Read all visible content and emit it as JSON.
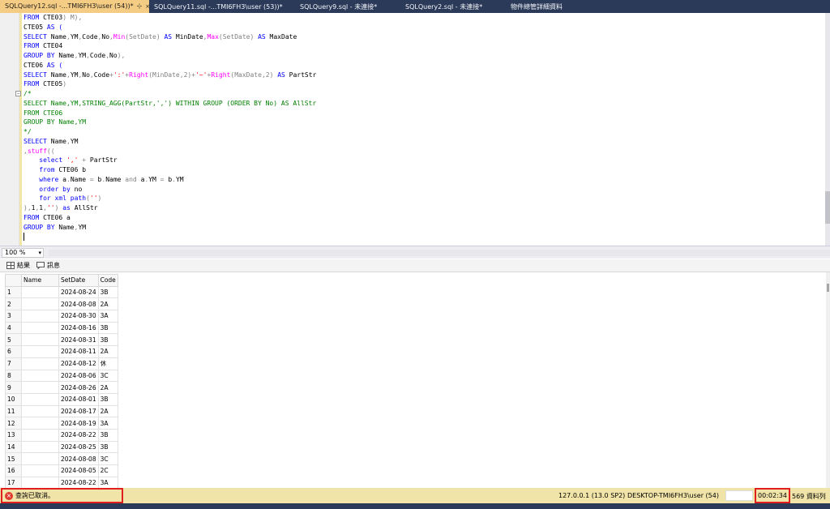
{
  "tabs": [
    {
      "label": "SQLQuery12.sql -...TMI6FH3\\user (54))*",
      "active": true
    },
    {
      "label": "SQLQuery11.sql -...TMI6FH3\\user (53))*",
      "active": false
    },
    {
      "label": "SQLQuery9.sql - 未連接*",
      "active": false
    },
    {
      "label": "SQLQuery2.sql - 未連接*",
      "active": false
    },
    {
      "label": "物件總管詳細資料",
      "active": false
    }
  ],
  "tab_controls": {
    "dropdown": "▾",
    "pin": "⊹",
    "close": "×"
  },
  "editor": {
    "lines": [
      [
        {
          "t": "FROM ",
          "c": "kw"
        },
        {
          "t": "CTE03",
          "c": ""
        },
        {
          "t": ") M),",
          "c": "gray"
        }
      ],
      [
        {
          "t": "CTE05 ",
          "c": ""
        },
        {
          "t": "AS (",
          "c": "kw"
        }
      ],
      [
        {
          "t": "SELECT ",
          "c": "kw"
        },
        {
          "t": "Name",
          "c": ""
        },
        {
          "t": ",",
          "c": "gray"
        },
        {
          "t": "YM",
          "c": ""
        },
        {
          "t": ",",
          "c": "gray"
        },
        {
          "t": "Code",
          "c": ""
        },
        {
          "t": ",",
          "c": "gray"
        },
        {
          "t": "No",
          "c": ""
        },
        {
          "t": ",",
          "c": "gray"
        },
        {
          "t": "Min",
          "c": "fn"
        },
        {
          "t": "(SetDate) ",
          "c": "gray"
        },
        {
          "t": "AS ",
          "c": "kw"
        },
        {
          "t": "MinDate",
          "c": ""
        },
        {
          "t": ",",
          "c": "gray"
        },
        {
          "t": "Max",
          "c": "fn"
        },
        {
          "t": "(SetDate) ",
          "c": "gray"
        },
        {
          "t": "AS ",
          "c": "kw"
        },
        {
          "t": "MaxDate",
          "c": ""
        }
      ],
      [
        {
          "t": "FROM ",
          "c": "kw"
        },
        {
          "t": "CTE04",
          "c": ""
        }
      ],
      [
        {
          "t": "GROUP BY ",
          "c": "kw"
        },
        {
          "t": "Name",
          "c": ""
        },
        {
          "t": ",",
          "c": "gray"
        },
        {
          "t": "YM",
          "c": ""
        },
        {
          "t": ",",
          "c": "gray"
        },
        {
          "t": "Code",
          "c": ""
        },
        {
          "t": ",",
          "c": "gray"
        },
        {
          "t": "No",
          "c": ""
        },
        {
          "t": "),",
          "c": "gray"
        }
      ],
      [
        {
          "t": "CTE06 ",
          "c": ""
        },
        {
          "t": "AS (",
          "c": "kw"
        }
      ],
      [
        {
          "t": "SELECT ",
          "c": "kw"
        },
        {
          "t": "Name",
          "c": ""
        },
        {
          "t": ",",
          "c": "gray"
        },
        {
          "t": "YM",
          "c": ""
        },
        {
          "t": ",",
          "c": "gray"
        },
        {
          "t": "No",
          "c": ""
        },
        {
          "t": ",",
          "c": "gray"
        },
        {
          "t": "Code",
          "c": ""
        },
        {
          "t": "+",
          "c": "gray"
        },
        {
          "t": "':'",
          "c": "str"
        },
        {
          "t": "+",
          "c": "gray"
        },
        {
          "t": "Right",
          "c": "fn"
        },
        {
          "t": "(MinDate,2)",
          "c": "gray"
        },
        {
          "t": "+",
          "c": "gray"
        },
        {
          "t": "'~'",
          "c": "str"
        },
        {
          "t": "+",
          "c": "gray"
        },
        {
          "t": "Right",
          "c": "fn"
        },
        {
          "t": "(MaxDate,2) ",
          "c": "gray"
        },
        {
          "t": "AS ",
          "c": "kw"
        },
        {
          "t": "PartStr",
          "c": ""
        }
      ],
      [
        {
          "t": "FROM ",
          "c": "kw"
        },
        {
          "t": "CTE05",
          "c": ""
        },
        {
          "t": ")",
          "c": "gray"
        }
      ],
      [
        {
          "t": "/*",
          "c": "cmt"
        }
      ],
      [
        {
          "t": "SELECT Name,YM,STRING_AGG(PartStr,',') WITHIN GROUP (ORDER BY No) AS AllStr",
          "c": "cmt"
        }
      ],
      [
        {
          "t": "FROM CTE06",
          "c": "cmt"
        }
      ],
      [
        {
          "t": "GROUP BY Name,YM",
          "c": "cmt"
        }
      ],
      [
        {
          "t": "*/",
          "c": "cmt"
        }
      ],
      [
        {
          "t": "SELECT ",
          "c": "kw"
        },
        {
          "t": "Name",
          "c": ""
        },
        {
          "t": ",",
          "c": "gray"
        },
        {
          "t": "YM",
          "c": ""
        }
      ],
      [
        {
          "t": ",",
          "c": "gray"
        },
        {
          "t": "stuff",
          "c": "fn"
        },
        {
          "t": "((",
          "c": "gray"
        }
      ],
      [
        {
          "t": "    select ",
          "c": "kw"
        },
        {
          "t": "','",
          "c": "str"
        },
        {
          "t": " + ",
          "c": "gray"
        },
        {
          "t": "PartStr",
          "c": ""
        }
      ],
      [
        {
          "t": "    from ",
          "c": "kw"
        },
        {
          "t": "CTE06 b",
          "c": ""
        }
      ],
      [
        {
          "t": "    where ",
          "c": "kw"
        },
        {
          "t": "a",
          "c": ""
        },
        {
          "t": ".",
          "c": "gray"
        },
        {
          "t": "Name",
          "c": ""
        },
        {
          "t": " = ",
          "c": "gray"
        },
        {
          "t": "b",
          "c": ""
        },
        {
          "t": ".",
          "c": "gray"
        },
        {
          "t": "Name ",
          "c": ""
        },
        {
          "t": "and ",
          "c": "gray"
        },
        {
          "t": "a",
          "c": ""
        },
        {
          "t": ".",
          "c": "gray"
        },
        {
          "t": "YM",
          "c": ""
        },
        {
          "t": " = ",
          "c": "gray"
        },
        {
          "t": "b",
          "c": ""
        },
        {
          "t": ".",
          "c": "gray"
        },
        {
          "t": "YM",
          "c": ""
        }
      ],
      [
        {
          "t": "    order by ",
          "c": "kw"
        },
        {
          "t": "no",
          "c": ""
        }
      ],
      [
        {
          "t": "    for xml path",
          "c": "kw"
        },
        {
          "t": "(",
          "c": "gray"
        },
        {
          "t": "''",
          "c": "str"
        },
        {
          "t": ")",
          "c": "gray"
        }
      ],
      [
        {
          "t": "),",
          "c": "gray"
        },
        {
          "t": "1",
          "c": ""
        },
        {
          "t": ",",
          "c": "gray"
        },
        {
          "t": "1",
          "c": ""
        },
        {
          "t": ",",
          "c": "gray"
        },
        {
          "t": "''",
          "c": "str"
        },
        {
          "t": ") ",
          "c": "gray"
        },
        {
          "t": "as ",
          "c": "kw"
        },
        {
          "t": "AllStr",
          "c": ""
        }
      ],
      [
        {
          "t": "FROM ",
          "c": "kw"
        },
        {
          "t": "CTE06 a",
          "c": ""
        }
      ],
      [
        {
          "t": "GROUP BY ",
          "c": "kw"
        },
        {
          "t": "Name",
          "c": ""
        },
        {
          "t": ",",
          "c": "gray"
        },
        {
          "t": "YM",
          "c": ""
        }
      ],
      []
    ],
    "fold_markers": [
      {
        "line": 8,
        "symbol": "−"
      }
    ]
  },
  "zoom": {
    "value": "100 %"
  },
  "results_tabs": [
    {
      "label": "結果",
      "icon": "grid-icon"
    },
    {
      "label": "訊息",
      "icon": "message-icon"
    }
  ],
  "grid": {
    "columns": [
      "Name",
      "SetDate",
      "Code"
    ],
    "rows": [
      [
        "1",
        "",
        "2024-08-24",
        "3B"
      ],
      [
        "2",
        "",
        "2024-08-08",
        "2A"
      ],
      [
        "3",
        "",
        "2024-08-30",
        "3A"
      ],
      [
        "4",
        "",
        "2024-08-16",
        "3B"
      ],
      [
        "5",
        "",
        "2024-08-31",
        "3B"
      ],
      [
        "6",
        "",
        "2024-08-11",
        "2A"
      ],
      [
        "7",
        "",
        "2024-08-12",
        "休"
      ],
      [
        "8",
        "",
        "2024-08-06",
        "3C"
      ],
      [
        "9",
        "",
        "2024-08-26",
        "2A"
      ],
      [
        "10",
        "",
        "2024-08-01",
        "3B"
      ],
      [
        "11",
        "",
        "2024-08-17",
        "2A"
      ],
      [
        "12",
        "",
        "2024-08-19",
        "3A"
      ],
      [
        "13",
        "",
        "2024-08-22",
        "3B"
      ],
      [
        "14",
        "",
        "2024-08-25",
        "3B"
      ],
      [
        "15",
        "",
        "2024-08-08",
        "3C"
      ],
      [
        "16",
        "",
        "2024-08-05",
        "2C"
      ],
      [
        "17",
        "",
        "2024-08-22",
        "3A"
      ]
    ]
  },
  "status": {
    "message": "查詢已取消。",
    "server": "127.0.0.1 (13.0 SP2)",
    "user": "DESKTOP-TMI6FH3\\user (54)",
    "database": "",
    "elapsed": "00:02:34",
    "rows": "569 資料列"
  },
  "colors": {
    "tab_active": "#f5cc84",
    "status_bg": "#f1e4a8",
    "highlight_box": "#e01f1f",
    "chrome": "#2b3a58"
  }
}
